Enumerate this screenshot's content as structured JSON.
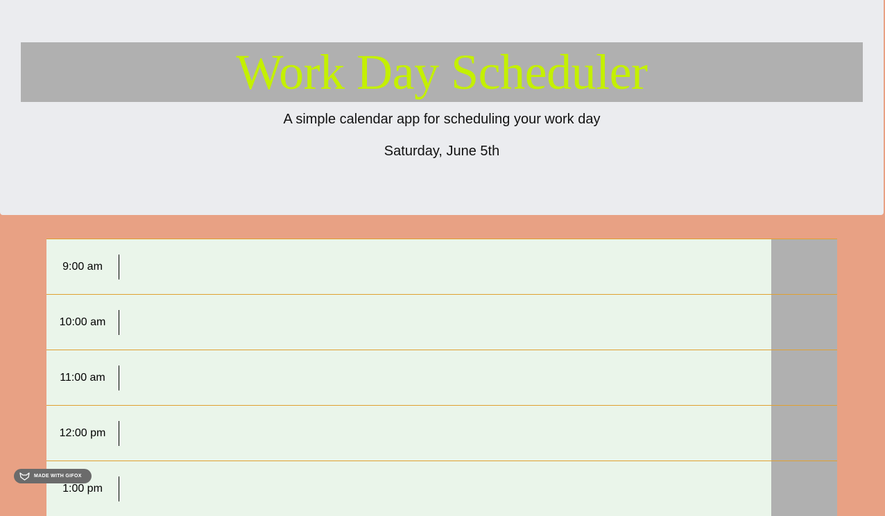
{
  "header": {
    "title": "Work Day Scheduler",
    "subtitle": "A simple calendar app for scheduling your work day",
    "current_date": "Saturday, June 5th"
  },
  "schedule": {
    "rows": [
      {
        "hour": "9:00 am",
        "text": ""
      },
      {
        "hour": "10:00 am",
        "text": ""
      },
      {
        "hour": "11:00 am",
        "text": ""
      },
      {
        "hour": "12:00 pm",
        "text": ""
      },
      {
        "hour": "1:00 pm",
        "text": ""
      }
    ]
  },
  "badge": {
    "label": "MADE WITH GIFOX",
    "icon": "fox-icon"
  },
  "colors": {
    "title": "#c4f000",
    "title_bar": "#b0b0b0",
    "header_bg": "#ebecef",
    "page_bg": "#e8a184",
    "row_bg": "#eaf5ea",
    "row_border": "#e0a030",
    "save_button": "#b0b0b0"
  }
}
